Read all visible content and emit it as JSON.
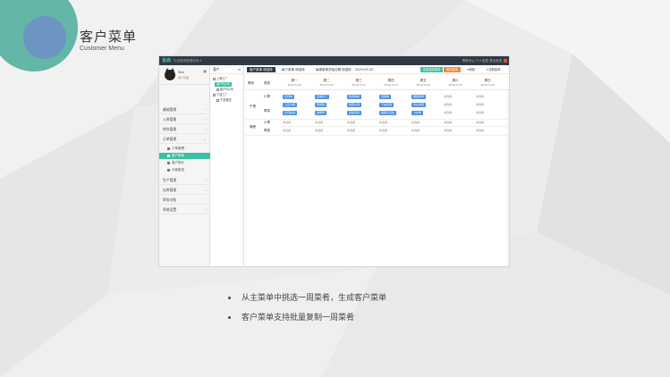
{
  "slide": {
    "title": "客户菜单",
    "subtitle": "Customer Menu",
    "bullets": [
      "从主菜单中挑选一周菜肴，生成客户菜单",
      "客户菜单支持批量复制一周菜肴"
    ]
  },
  "app": {
    "brand": "瓦尚",
    "brand_sub": "中央厨房管理系统 ▾",
    "top_right": "帮助中心   个人信息   退出系统",
    "profile": {
      "name": "Tom",
      "role": "客户管理"
    },
    "menu": [
      {
        "label": "基础管理"
      },
      {
        "label": "入库管理"
      },
      {
        "label": "库存管理"
      },
      {
        "label": "订单管理"
      }
    ],
    "submenu": [
      {
        "label": "订单管理"
      },
      {
        "label": "客户菜单"
      },
      {
        "label": "客户报价"
      },
      {
        "label": "分客配送"
      }
    ],
    "menu2": [
      {
        "label": "生产管理"
      },
      {
        "label": "出库管理"
      },
      {
        "label": "财务对账"
      },
      {
        "label": "系统设置"
      }
    ],
    "tree": {
      "header": "客户",
      "switch": "⇌",
      "nodes": [
        "上海工厂",
        "客户A公司",
        "客户B公司",
        "宁波工厂",
        "宁波食堂"
      ]
    },
    "toolbar": {
      "tab1": "客户菜单 请选择",
      "tab2": "每个菜单·请选择",
      "field1_label": "每周菜单开始日期·请选择",
      "date": "2019-05-20",
      "btn1": "批量复制菜单",
      "btn2": "保存菜单",
      "link1": "刷新",
      "link2": "复制菜单"
    },
    "week": {
      "col_meal": "餐段",
      "col_type": "类型",
      "days": [
        {
          "name": "周一",
          "date": "2019.5.20"
        },
        {
          "name": "周二",
          "date": "2019.5.21"
        },
        {
          "name": "周三",
          "date": "2019.5.22"
        },
        {
          "name": "周四",
          "date": "2019.5.23"
        },
        {
          "name": "周五",
          "date": "2019.5.24"
        },
        {
          "name": "周六",
          "date": "2019.5.25"
        },
        {
          "name": "周日",
          "date": "2019.5.26"
        }
      ]
    },
    "meals": {
      "lunch": "午餐",
      "dinner": "晚餐",
      "type_meat": "荤菜",
      "type_veg": "素菜",
      "type_light": "小荤"
    },
    "lunch_tags": [
      [
        "红烧肉",
        "宫保鸡丁",
        "鱼香肉丝",
        "回锅肉",
        "糖醋排骨"
      ],
      [
        "土豆牛腩",
        "黄焖鸡",
        "番茄炒蛋",
        "干煸豆角",
        "清炒时蔬"
      ],
      [
        "红烧鱼块",
        "咖喱鸡",
        "麻婆豆腐",
        "酸辣土豆丝",
        "小炒肉"
      ]
    ],
    "unselected": "未选择"
  },
  "colors": {
    "accent": "#3cc0a4",
    "tag": "#4a90e2",
    "topbar": "#2f3a45"
  }
}
